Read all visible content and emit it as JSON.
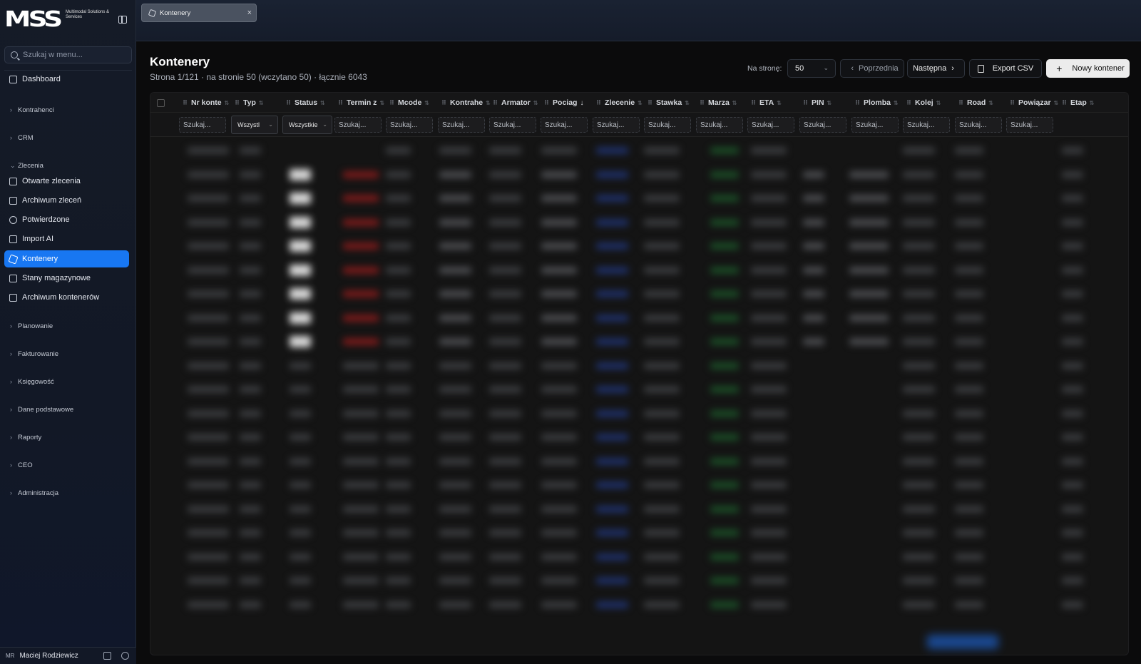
{
  "sidebar": {
    "logo_text": "MSS",
    "logo_sub": "Multimodal Solutions & Services",
    "search_placeholder": "Szukaj w menu...",
    "dashboard": "Dashboard",
    "groups": {
      "kontrahenci": "Kontrahenci",
      "crm": "CRM",
      "zlecenia": "Zlecenia",
      "planowanie": "Planowanie",
      "fakturowanie": "Fakturowanie",
      "ksiegowosc": "Księgowość",
      "dane": "Dane podstawowe",
      "raporty": "Raporty",
      "ceo": "CEO",
      "admin": "Administracja"
    },
    "items": {
      "otwarte": "Otwarte zlecenia",
      "archiwum_zlecen": "Archiwum zleceń",
      "potwierdzone": "Potwierdzone",
      "import_ai": "Import AI",
      "kontenery": "Kontenery",
      "stany": "Stany magazynowe",
      "archiwum_kontenerow": "Archiwum kontenerów"
    },
    "user": {
      "initials": "MR",
      "name": "Maciej Rodziewicz"
    }
  },
  "tabs": [
    {
      "label": "Kontenery"
    }
  ],
  "header": {
    "title": "Kontenery",
    "subtitle": "Strona 1/121 · na stronie 50 (wczytano 50) · łącznie 6043",
    "per_page_label": "Na stronę:",
    "per_page_value": "50",
    "prev_label": "Poprzednia",
    "next_label": "Następna",
    "export_label": "Export CSV",
    "new_label": "Nowy kontener"
  },
  "table": {
    "columns": [
      "Nr konte",
      "Typ",
      "Status",
      "Termin z",
      "Mcode",
      "Kontrahe",
      "Armator",
      "Pociag",
      "Zlecenie",
      "Stawka",
      "Marza",
      "ETA",
      "PIN",
      "Plomba",
      "Kolej",
      "Road",
      "Powiązar",
      "Etap"
    ],
    "filter_placeholder": "Szukaj...",
    "typ_filter": "Wszystl",
    "status_filter": "Wszystkie"
  },
  "colors": {
    "accent": "#1877f2",
    "background": "#0b0b0c",
    "sidebar": "#151b27"
  }
}
